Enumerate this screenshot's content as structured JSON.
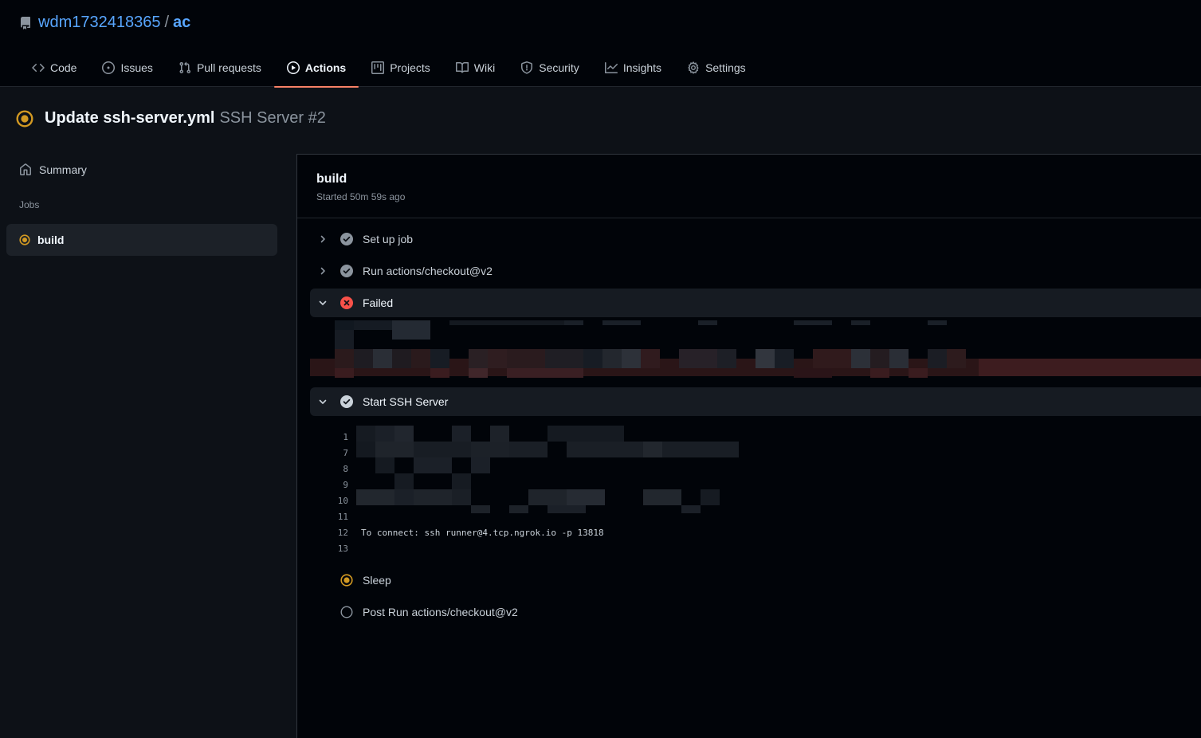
{
  "repo": {
    "owner": "wdm1732418365",
    "separator": "/",
    "name": "ac"
  },
  "tabs": [
    {
      "label": "Code",
      "icon": "code-icon"
    },
    {
      "label": "Issues",
      "icon": "issue-icon"
    },
    {
      "label": "Pull requests",
      "icon": "pull-request-icon"
    },
    {
      "label": "Actions",
      "icon": "play-icon",
      "active": true
    },
    {
      "label": "Projects",
      "icon": "project-icon"
    },
    {
      "label": "Wiki",
      "icon": "book-icon"
    },
    {
      "label": "Security",
      "icon": "shield-icon"
    },
    {
      "label": "Insights",
      "icon": "graph-icon"
    },
    {
      "label": "Settings",
      "icon": "gear-icon"
    }
  ],
  "run": {
    "commit_message": "Update ssh-server.yml",
    "workflow": "SSH Server #2",
    "status": "in_progress"
  },
  "sidebar": {
    "summary_label": "Summary",
    "jobs_heading": "Jobs",
    "jobs": [
      {
        "label": "build",
        "status": "in_progress"
      }
    ]
  },
  "job": {
    "name": "build",
    "started": "Started 50m 59s ago"
  },
  "steps": [
    {
      "label": "Set up job",
      "status": "success",
      "expanded": false
    },
    {
      "label": "Run actions/checkout@v2",
      "status": "success",
      "expanded": false
    },
    {
      "label": "Failed",
      "status": "failure",
      "expanded": true
    },
    {
      "label": "Start SSH Server",
      "status": "success",
      "expanded": true
    },
    {
      "label": "Sleep",
      "status": "in_progress"
    },
    {
      "label": "Post Run actions/checkout@v2",
      "status": "pending"
    }
  ],
  "ssh_log": {
    "line_numbers": [
      "1",
      "7",
      "8",
      "9",
      "10",
      "11",
      "12",
      "13"
    ],
    "connect_line": "To connect: ssh runner@4.tcp.ngrok.io -p 13818"
  },
  "colors": {
    "accent": "#f78166",
    "link": "#58a6ff",
    "in_progress": "#d29922",
    "failure": "#f85149",
    "success": "#8b949e"
  }
}
